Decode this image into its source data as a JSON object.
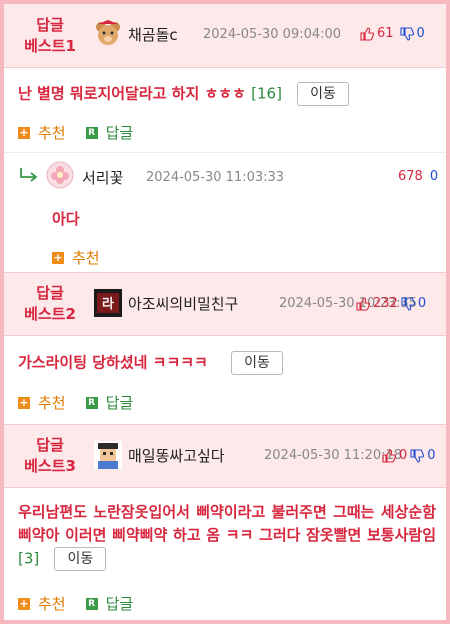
{
  "colors": {
    "accent": "#d7263d",
    "border": "#f7b8bf",
    "header_bg": "#fde8ea",
    "recommend": "#e07b00",
    "reply": "#2e8b3e",
    "down": "#1f4fd1"
  },
  "best1": {
    "label_line1": "답글",
    "label_line2": "베스트1",
    "avatar_icon": "teddy-bear-icon",
    "nickname": "채곰돌c",
    "date": "2024-05-30 09:04:00",
    "upvotes": "61",
    "downvotes": "0",
    "content": "난 별명 뭐로지어달라고 하지 ㅎㅎㅎ",
    "reply_count": "[16]",
    "move_label": "이동",
    "recommend_label": "추천",
    "reply_label": "답글"
  },
  "reply1": {
    "avatar_icon": "flower-avatar-icon",
    "nickname": "서리꽃",
    "date": "2024-05-30 11:03:33",
    "upvotes": "678",
    "downvotes": "0",
    "content": "아다",
    "recommend_label": "추천"
  },
  "best2": {
    "label_line1": "답글",
    "label_line2": "베스트2",
    "avatar_icon": "character-avatar-icon",
    "nickname": "아조씨의비밀친구",
    "date": "2024-05-30 10:23:35",
    "upvotes": "232",
    "downvotes": "0",
    "content": "가스라이팅 당하셨네 ㅋㅋㅋㅋ",
    "move_label": "이동",
    "recommend_label": "추천",
    "reply_label": "답글"
  },
  "best3": {
    "label_line1": "답글",
    "label_line2": "베스트3",
    "avatar_icon": "pixel-person-icon",
    "nickname": "매일똥싸고싶다",
    "date": "2024-05-30 11:20:18",
    "upvotes": "0",
    "downvotes": "0",
    "content": "우리남편도 노란잠옷입어서 삐약이라고 불러주면 그때는 세상순함 삐약아 이러면 삐약삐약 하고 옴 ㅋㅋ 그러다 잠옷빨면 보통사람임",
    "reply_count": "[3]",
    "move_label": "이동",
    "recommend_label": "추천",
    "reply_label": "답글"
  }
}
